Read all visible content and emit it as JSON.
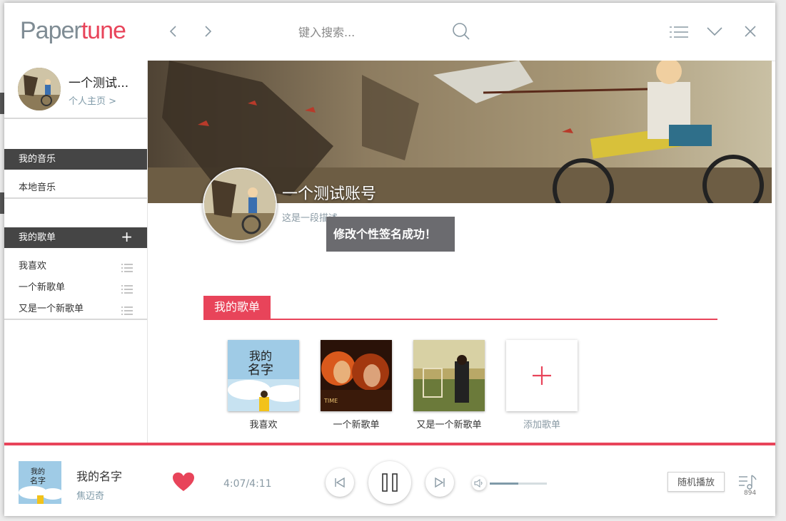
{
  "app": {
    "logo_paper": "Paper",
    "logo_tune": "tune",
    "search_placeholder": "键入搜索..."
  },
  "sidebar": {
    "profile_name": "一个测试...",
    "profile_link": "个人主页 >",
    "my_music_title": "我的音乐",
    "my_music_items": [
      {
        "label": "本地音乐"
      }
    ],
    "my_playlists_title": "我的歌单",
    "add_icon": "plus-icon",
    "playlists": [
      {
        "label": "我喜欢"
      },
      {
        "label": "一个新歌单"
      },
      {
        "label": "又是一个新歌单"
      }
    ]
  },
  "profile": {
    "name": "一个测试账号",
    "description": "这是一段描述",
    "toast": "修改个性签名成功！"
  },
  "playlists_section": {
    "title": "我的歌单",
    "cards": [
      {
        "label": "我喜欢"
      },
      {
        "label": "一个新歌单"
      },
      {
        "label": "又是一个新歌单"
      }
    ],
    "add_label": "添加歌单"
  },
  "player": {
    "title": "我的名字",
    "artist": "焦迈奇",
    "time": "4:07/4:11",
    "volume_level": 0.5,
    "shuffle_label": "随机播放",
    "queue_count": "894"
  },
  "colors": {
    "accent": "#e8445a",
    "dark_header": "#454545",
    "muted": "#7f9aa8"
  }
}
